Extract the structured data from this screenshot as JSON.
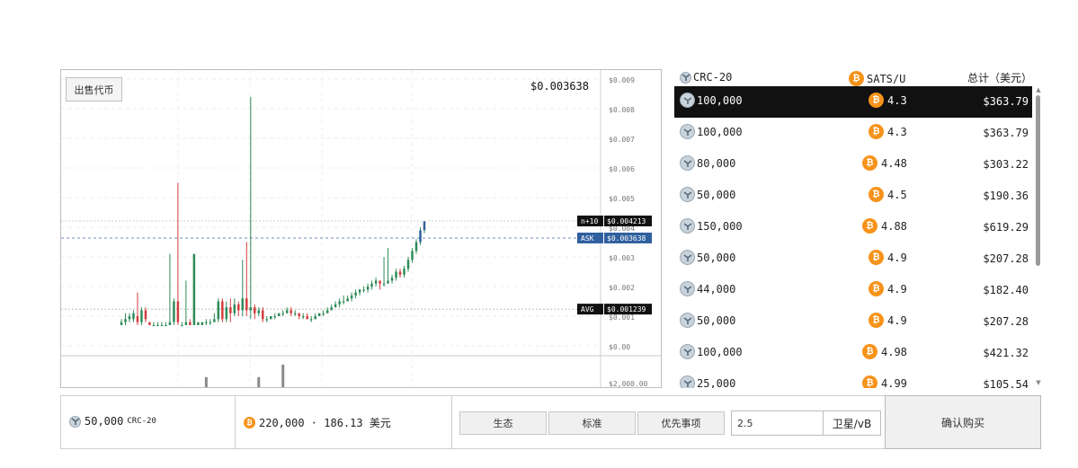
{
  "chart": {
    "sell_button": "出售代币",
    "current_price": "$0.003638",
    "tags": {
      "n10": {
        "label": "n+10",
        "value": "$0.004213"
      },
      "ask": {
        "label": "ASK",
        "value": "$0.003638"
      },
      "avg": {
        "label": "AVG",
        "value": "$0.001239"
      }
    },
    "volume_label": "$2,000.00"
  },
  "chart_data": {
    "type": "candlestick",
    "y_ticks": [
      "$0.009",
      "$0.008",
      "$0.007",
      "$0.006",
      "$0.005",
      "$0.004",
      "$0.003",
      "$0.002",
      "$0.001",
      "$0.00"
    ],
    "ylim": [
      0,
      0.009
    ],
    "reference_lines": {
      "n+10": 0.004213,
      "ASK": 0.003638,
      "AVG": 0.001239
    },
    "candles": [
      {
        "o": 0.0007,
        "c": 0.0008,
        "h": 0.0009,
        "l": 0.0007
      },
      {
        "o": 0.0008,
        "c": 0.0009,
        "h": 0.0011,
        "l": 0.0007
      },
      {
        "o": 0.0009,
        "c": 0.001,
        "h": 0.0011,
        "l": 0.0008
      },
      {
        "o": 0.0009,
        "c": 0.0011,
        "h": 0.0012,
        "l": 0.0008
      },
      {
        "o": 0.001,
        "c": 0.0008,
        "h": 0.0018,
        "l": 0.0007
      },
      {
        "o": 0.0008,
        "c": 0.0012,
        "h": 0.0013,
        "l": 0.0007
      },
      {
        "o": 0.0012,
        "c": 0.0009,
        "h": 0.0013,
        "l": 0.0008
      },
      {
        "o": 0.0008,
        "c": 0.0007,
        "h": 0.0008,
        "l": 0.0007
      },
      {
        "o": 0.0007,
        "c": 0.0007,
        "h": 0.0008,
        "l": 0.0007
      },
      {
        "o": 0.0007,
        "c": 0.0007,
        "h": 0.0008,
        "l": 0.0007
      },
      {
        "o": 0.0007,
        "c": 0.0007,
        "h": 0.0008,
        "l": 0.0007
      },
      {
        "o": 0.0007,
        "c": 0.0007,
        "h": 0.0008,
        "l": 0.0007
      },
      {
        "o": 0.0007,
        "c": 0.0008,
        "h": 0.0031,
        "l": 0.0007
      },
      {
        "o": 0.0008,
        "c": 0.0015,
        "h": 0.0016,
        "l": 0.0007
      },
      {
        "o": 0.0015,
        "c": 0.0008,
        "h": 0.0055,
        "l": 0.0007
      },
      {
        "o": 0.0007,
        "c": 0.0007,
        "h": 0.0008,
        "l": 0.0007
      },
      {
        "o": 0.0007,
        "c": 0.0008,
        "h": 0.0022,
        "l": 0.0007
      },
      {
        "o": 0.0008,
        "c": 0.0007,
        "h": 0.0009,
        "l": 0.0007
      },
      {
        "o": 0.0007,
        "c": 0.0031,
        "h": 0.0031,
        "l": 0.0007
      },
      {
        "o": 0.0007,
        "c": 0.0008,
        "h": 0.0008,
        "l": 0.0007
      },
      {
        "o": 0.0007,
        "c": 0.0008,
        "h": 0.0008,
        "l": 0.0007
      },
      {
        "o": 0.0008,
        "c": 0.0008,
        "h": 0.0009,
        "l": 0.0007
      },
      {
        "o": 0.0008,
        "c": 0.0008,
        "h": 0.0009,
        "l": 0.0007
      },
      {
        "o": 0.0008,
        "c": 0.0009,
        "h": 0.0011,
        "l": 0.0008
      },
      {
        "o": 0.0009,
        "c": 0.0015,
        "h": 0.0016,
        "l": 0.0008
      },
      {
        "o": 0.0015,
        "c": 0.0009,
        "h": 0.0016,
        "l": 0.0008
      },
      {
        "o": 0.0009,
        "c": 0.0013,
        "h": 0.0015,
        "l": 0.0008
      },
      {
        "o": 0.0013,
        "c": 0.0011,
        "h": 0.0016,
        "l": 0.0008
      },
      {
        "o": 0.0011,
        "c": 0.0014,
        "h": 0.0016,
        "l": 0.001
      },
      {
        "o": 0.0014,
        "c": 0.0012,
        "h": 0.0015,
        "l": 0.001
      },
      {
        "o": 0.0012,
        "c": 0.0016,
        "h": 0.0029,
        "l": 0.001
      },
      {
        "o": 0.0016,
        "c": 0.0012,
        "h": 0.0035,
        "l": 0.001
      },
      {
        "o": 0.0012,
        "c": 0.0013,
        "h": 0.0084,
        "l": 0.0009
      },
      {
        "o": 0.0013,
        "c": 0.0011,
        "h": 0.0014,
        "l": 0.0009
      },
      {
        "o": 0.0011,
        "c": 0.0012,
        "h": 0.0013,
        "l": 0.001
      },
      {
        "o": 0.0012,
        "c": 0.0009,
        "h": 0.0013,
        "l": 0.0008
      },
      {
        "o": 0.0009,
        "c": 0.0009,
        "h": 0.001,
        "l": 0.0008
      },
      {
        "o": 0.0009,
        "c": 0.001,
        "h": 0.001,
        "l": 0.0009
      },
      {
        "o": 0.001,
        "c": 0.001,
        "h": 0.0011,
        "l": 0.0009
      },
      {
        "o": 0.001,
        "c": 0.0011,
        "h": 0.0011,
        "l": 0.001
      },
      {
        "o": 0.0011,
        "c": 0.0011,
        "h": 0.0012,
        "l": 0.001
      },
      {
        "o": 0.0011,
        "c": 0.0012,
        "h": 0.0013,
        "l": 0.0011
      },
      {
        "o": 0.0012,
        "c": 0.0011,
        "h": 0.0013,
        "l": 0.001
      },
      {
        "o": 0.0011,
        "c": 0.0011,
        "h": 0.0012,
        "l": 0.001
      },
      {
        "o": 0.0011,
        "c": 0.001,
        "h": 0.0011,
        "l": 0.0009
      },
      {
        "o": 0.001,
        "c": 0.001,
        "h": 0.0011,
        "l": 0.0009
      },
      {
        "o": 0.001,
        "c": 0.0009,
        "h": 0.0011,
        "l": 0.0009
      },
      {
        "o": 0.0009,
        "c": 0.0009,
        "h": 0.001,
        "l": 0.0008
      },
      {
        "o": 0.0009,
        "c": 0.001,
        "h": 0.0011,
        "l": 0.0009
      },
      {
        "o": 0.001,
        "c": 0.0011,
        "h": 0.0011,
        "l": 0.001
      },
      {
        "o": 0.0011,
        "c": 0.0011,
        "h": 0.0012,
        "l": 0.001
      },
      {
        "o": 0.0011,
        "c": 0.0012,
        "h": 0.0013,
        "l": 0.0011
      },
      {
        "o": 0.0012,
        "c": 0.0013,
        "h": 0.0014,
        "l": 0.0012
      },
      {
        "o": 0.0013,
        "c": 0.0014,
        "h": 0.0015,
        "l": 0.0013
      },
      {
        "o": 0.0014,
        "c": 0.0015,
        "h": 0.0016,
        "l": 0.0013
      },
      {
        "o": 0.0015,
        "c": 0.0015,
        "h": 0.0017,
        "l": 0.0014
      },
      {
        "o": 0.0015,
        "c": 0.0016,
        "h": 0.0017,
        "l": 0.0015
      },
      {
        "o": 0.0016,
        "c": 0.0017,
        "h": 0.0018,
        "l": 0.0015
      },
      {
        "o": 0.0017,
        "c": 0.0018,
        "h": 0.0019,
        "l": 0.0016
      },
      {
        "o": 0.0018,
        "c": 0.0019,
        "h": 0.0019,
        "l": 0.0017
      },
      {
        "o": 0.0019,
        "c": 0.0019,
        "h": 0.002,
        "l": 0.0018
      },
      {
        "o": 0.0019,
        "c": 0.002,
        "h": 0.0021,
        "l": 0.0018
      },
      {
        "o": 0.002,
        "c": 0.0021,
        "h": 0.0022,
        "l": 0.0019
      },
      {
        "o": 0.0021,
        "c": 0.0022,
        "h": 0.0023,
        "l": 0.002
      },
      {
        "o": 0.0022,
        "c": 0.0021,
        "h": 0.0022,
        "l": 0.0019
      },
      {
        "o": 0.0021,
        "c": 0.0021,
        "h": 0.003,
        "l": 0.002
      },
      {
        "o": 0.0021,
        "c": 0.0022,
        "h": 0.0033,
        "l": 0.0021
      },
      {
        "o": 0.0022,
        "c": 0.0023,
        "h": 0.0024,
        "l": 0.0021
      },
      {
        "o": 0.0023,
        "c": 0.0025,
        "h": 0.0026,
        "l": 0.0022
      },
      {
        "o": 0.0025,
        "c": 0.0024,
        "h": 0.0026,
        "l": 0.0023
      },
      {
        "o": 0.0024,
        "c": 0.0026,
        "h": 0.0027,
        "l": 0.0023
      },
      {
        "o": 0.0026,
        "c": 0.0029,
        "h": 0.003,
        "l": 0.0025
      },
      {
        "o": 0.0029,
        "c": 0.0032,
        "h": 0.0033,
        "l": 0.0028
      },
      {
        "o": 0.0032,
        "c": 0.0035,
        "h": 0.0036,
        "l": 0.0031
      },
      {
        "o": 0.0035,
        "c": 0.0039,
        "h": 0.004,
        "l": 0.0034
      },
      {
        "o": 0.0039,
        "c": 0.0042,
        "h": 0.0042,
        "l": 0.0038
      }
    ],
    "volume": [
      {
        "i": 21,
        "v": 0.4
      },
      {
        "i": 34,
        "v": 0.4
      },
      {
        "i": 40,
        "v": 0.9
      }
    ]
  },
  "book": {
    "header": {
      "token": "CRC-20",
      "rate": "SATS/U",
      "total": "总计（美元）"
    },
    "rows": [
      {
        "qty": "100,000",
        "rate": "4.3",
        "amount": "$363.79",
        "selected": true
      },
      {
        "qty": "100,000",
        "rate": "4.3",
        "amount": "$363.79"
      },
      {
        "qty": "80,000",
        "rate": "4.48",
        "amount": "$303.22"
      },
      {
        "qty": "50,000",
        "rate": "4.5",
        "amount": "$190.36"
      },
      {
        "qty": "150,000",
        "rate": "4.88",
        "amount": "$619.29"
      },
      {
        "qty": "50,000",
        "rate": "4.9",
        "amount": "$207.28"
      },
      {
        "qty": "44,000",
        "rate": "4.9",
        "amount": "$182.40"
      },
      {
        "qty": "50,000",
        "rate": "4.9",
        "amount": "$207.28"
      },
      {
        "qty": "100,000",
        "rate": "4.98",
        "amount": "$421.32"
      },
      {
        "qty": "25,000",
        "rate": "4.99",
        "amount": "$105.54"
      }
    ]
  },
  "order": {
    "qty": "50,000",
    "qty_token": "CRC-20",
    "price": "220,000 · 186.13 美元",
    "fee_buttons": [
      "生态",
      "标准",
      "优先事项"
    ],
    "fee_value": "2.5",
    "fee_unit": "卫星/vB",
    "confirm": "确认购买"
  },
  "colors": {
    "up": "#2e8b57",
    "down": "#d23b3b",
    "ask": "#2f5f9e",
    "selected_row": "#111111",
    "btc": "#f7931a"
  },
  "icons": {
    "token": "crc-token-icon",
    "sats": "bitcoin-icon"
  }
}
